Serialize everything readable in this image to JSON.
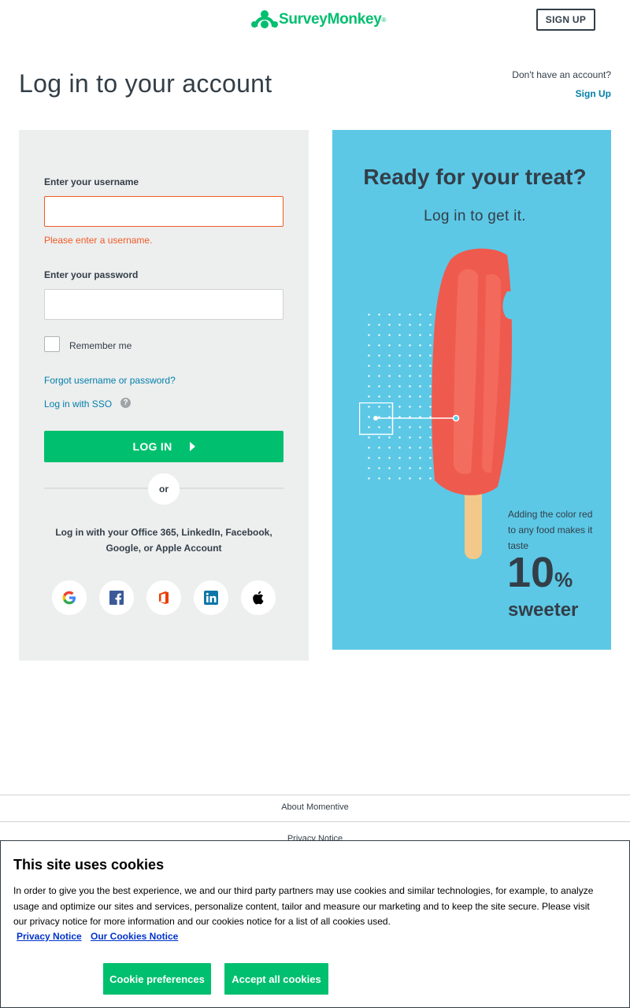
{
  "header": {
    "logo_text": "SurveyMonkey",
    "logo_reg": "®",
    "signup_button": "SIGN UP"
  },
  "page": {
    "title": "Log in to your account",
    "no_account_text": "Don't have an account?",
    "signup_link": "Sign Up"
  },
  "login_form": {
    "username_label": "Enter your username",
    "username_value": "",
    "username_error": "Please enter a username.",
    "password_label": "Enter your password",
    "password_value": "",
    "remember_me_label": "Remember me",
    "remember_me_checked": false,
    "forgot_link": "Forgot username or password?",
    "sso_link": "Log in with SSO",
    "sso_help_icon": "?",
    "login_button": "LOG IN",
    "divider_text": "or",
    "social_text": "Log in with your Office 365, LinkedIn, Facebook, Google, or Apple Account",
    "social_icons": [
      "google-icon",
      "facebook-icon",
      "office365-icon",
      "linkedin-icon",
      "apple-icon"
    ]
  },
  "promo": {
    "title": "Ready for your treat?",
    "subtitle": "Log in to get it.",
    "fact_text": "Adding the color red to any food makes it taste",
    "fact_number": "10",
    "fact_unit": "%",
    "fact_word": "sweeter",
    "background_color": "#5cc8e6"
  },
  "footer": {
    "about_link": "About Momentive",
    "privacy_link": "Privacy Notice"
  },
  "cookie_banner": {
    "title": "This site uses cookies",
    "body": "In order to give you the best experience, we and our third party partners may use cookies and similar technologies, for example, to analyze usage and optimize our sites and services, personalize content, tailor and measure our marketing and to keep the site secure. Please visit our privacy notice for more information and our cookies notice for a list of all cookies used.",
    "privacy_link": "Privacy Notice",
    "cookies_link": "Our Cookies Notice",
    "preferences_button": "Cookie preferences",
    "accept_button": "Accept all cookies"
  },
  "colors": {
    "brand_green": "#00bf6f",
    "link_blue": "#007faa",
    "error_orange": "#f05b24",
    "text_dark": "#333e48"
  }
}
